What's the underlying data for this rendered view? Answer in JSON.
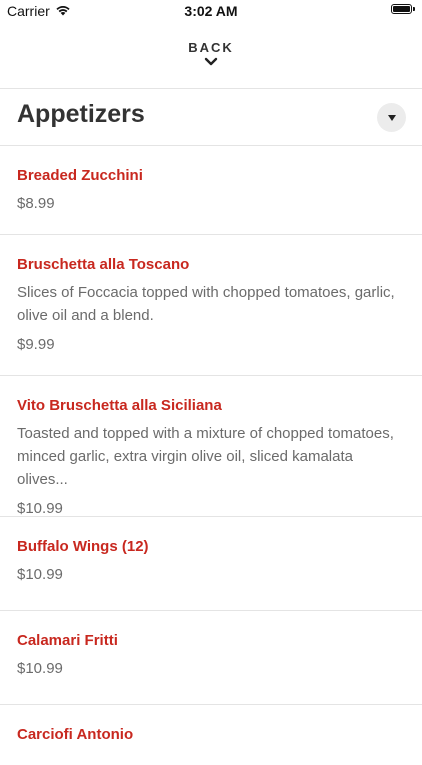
{
  "status_bar": {
    "carrier": "Carrier",
    "time": "3:02 AM"
  },
  "nav": {
    "back_label": "BACK"
  },
  "section": {
    "title": "Appetizers"
  },
  "colors": {
    "item_name": "#c8281f",
    "secondary_text": "#6b6b6b"
  },
  "menu_items": [
    {
      "name": "Breaded Zucchini",
      "description": "",
      "price": "$8.99"
    },
    {
      "name": "Bruschetta alla Toscano",
      "description": "Slices of Foccacia topped with chopped tomatoes, garlic, olive oil and a blend.",
      "price": "$9.99"
    },
    {
      "name": "Vito Bruschetta alla Siciliana",
      "description": "Toasted and topped with a mixture of chopped tomatoes, minced garlic, extra virgin olive oil, sliced kamalata olives...",
      "price": "$10.99"
    },
    {
      "name": "Buffalo Wings (12)",
      "description": "",
      "price": "$10.99"
    },
    {
      "name": "Calamari Fritti",
      "description": "",
      "price": "$10.99"
    },
    {
      "name": "Carciofi Antonio",
      "description": "",
      "price": ""
    }
  ]
}
